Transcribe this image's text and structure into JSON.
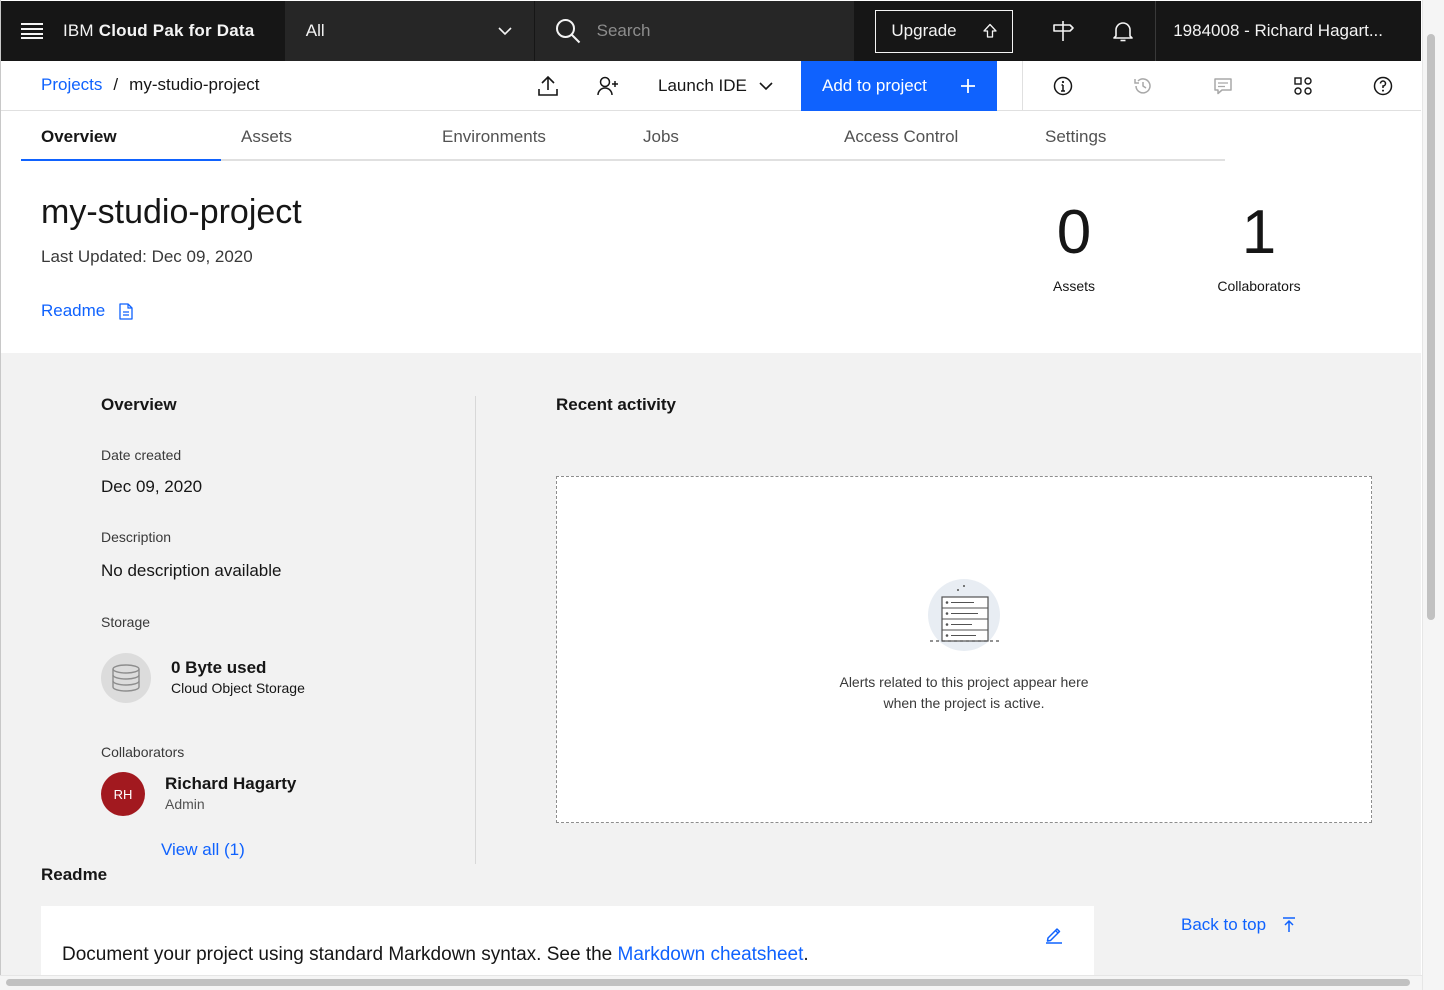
{
  "header": {
    "brand_prefix": "IBM",
    "brand_name": "Cloud Pak for Data",
    "scope": "All",
    "search_placeholder": "Search",
    "upgrade_label": "Upgrade",
    "account": "1984008 - Richard Hagart..."
  },
  "toolbar": {
    "breadcrumb_root": "Projects",
    "breadcrumb_sep": "/",
    "breadcrumb_current": "my-studio-project",
    "launch_ide": "Launch IDE",
    "add_to_project": "Add to project"
  },
  "tabs": [
    "Overview",
    "Assets",
    "Environments",
    "Jobs",
    "Access Control",
    "Settings"
  ],
  "project": {
    "title": "my-studio-project",
    "last_updated": "Last Updated: Dec 09, 2020",
    "readme_link": "Readme",
    "stats": [
      {
        "value": "0",
        "label": "Assets"
      },
      {
        "value": "1",
        "label": "Collaborators"
      }
    ]
  },
  "overview": {
    "title": "Overview",
    "date_created_label": "Date created",
    "date_created": "Dec 09, 2020",
    "description_label": "Description",
    "description": "No description available",
    "storage_label": "Storage",
    "storage_used": "0 Byte used",
    "storage_type": "Cloud Object Storage",
    "collaborators_label": "Collaborators",
    "collaborator_initials": "RH",
    "collaborator_name": "Richard Hagarty",
    "collaborator_role": "Admin",
    "view_all": "View all (1)"
  },
  "recent_activity": {
    "title": "Recent activity",
    "message_line1": "Alerts related to this project appear here",
    "message_line2": "when the project is active."
  },
  "readme": {
    "title": "Readme",
    "text_before": "Document your project using standard Markdown syntax. See the ",
    "link_text": "Markdown cheatsheet",
    "text_after": "."
  },
  "back_to_top": "Back to top",
  "colors": {
    "accent": "#0f62fe",
    "header_bg": "#161616",
    "avatar_bg": "#a2191f"
  }
}
